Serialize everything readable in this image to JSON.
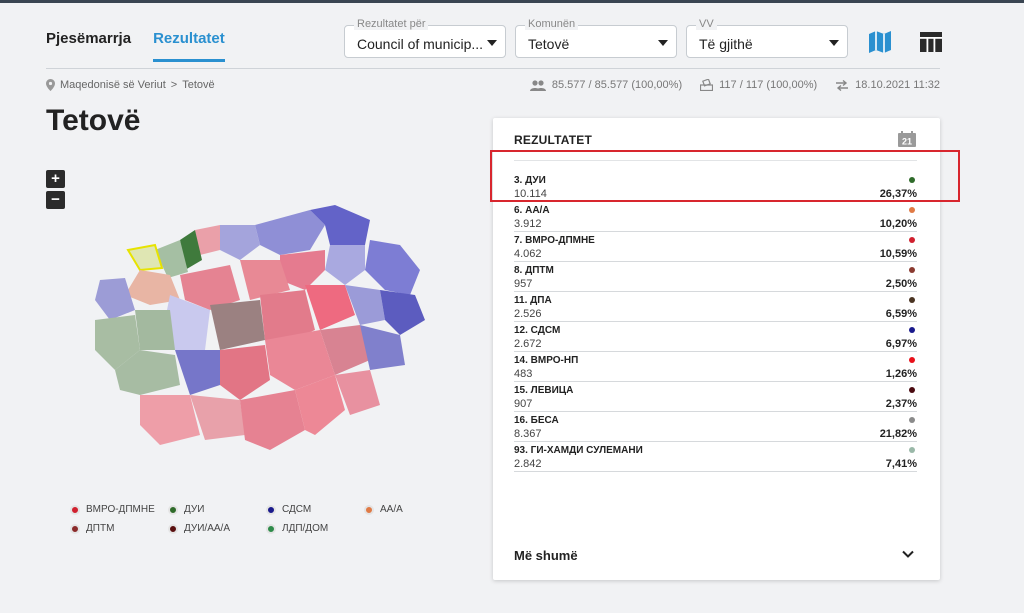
{
  "tabs": [
    {
      "label": "Pjesëmarrja",
      "active": false
    },
    {
      "label": "Rezultatet",
      "active": true
    }
  ],
  "filters": {
    "results_for": {
      "label": "Rezultatet për",
      "value": "Council of municip..."
    },
    "municipality": {
      "label": "Komunën",
      "value": "Tetovë"
    },
    "polling_station": {
      "label": "VV",
      "value": "Të gjithë"
    }
  },
  "breadcrumb": {
    "country": "Maqedonisë së Veriut",
    "separator": ">",
    "city": "Tetovë"
  },
  "stats": {
    "voters": "85.577 / 85.577 (100,00%)",
    "stations": "117 / 117 (100,00%)",
    "updated": "18.10.2021 11:32"
  },
  "page_title": "Tetovë",
  "zoom": {
    "in": "+",
    "out": "−"
  },
  "legend": [
    {
      "label": "ВМРО-ДПМНЕ",
      "color": "#d0202e"
    },
    {
      "label": "ДУИ",
      "color": "#2f6b2a"
    },
    {
      "label": "СДСМ",
      "color": "#1a1a8c"
    },
    {
      "label": "АА/А",
      "color": "#e07a45"
    },
    {
      "label": "ДПТМ",
      "color": "#8a2a2a"
    },
    {
      "label": "ДУИ/АА/А",
      "color": "#5a1010"
    },
    {
      "label": "ЛДП/ДОМ",
      "color": "#2e8b4a"
    }
  ],
  "panel": {
    "title": "REZULTATET",
    "calendar_badge": "21",
    "more_label": "Më shumë",
    "results": [
      {
        "name": "3. ДУИ",
        "votes": "10.114",
        "percent": "26,37%",
        "color": "#2f6b2a"
      },
      {
        "name": "6. АА/А",
        "votes": "3.912",
        "percent": "10,20%",
        "color": "#e07a45"
      },
      {
        "name": "7. ВМРО-ДПМНЕ",
        "votes": "4.062",
        "percent": "10,59%",
        "color": "#d0202e"
      },
      {
        "name": "8. ДПТМ",
        "votes": "957",
        "percent": "2,50%",
        "color": "#8a3a30"
      },
      {
        "name": "11. ДПА",
        "votes": "2.526",
        "percent": "6,59%",
        "color": "#4a3422"
      },
      {
        "name": "12. СДСМ",
        "votes": "2.672",
        "percent": "6,97%",
        "color": "#1a1a8c"
      },
      {
        "name": "14. ВМРО-НП",
        "votes": "483",
        "percent": "1,26%",
        "color": "#e8101a"
      },
      {
        "name": "15. ЛЕВИЦА",
        "votes": "907",
        "percent": "2,37%",
        "color": "#4a0a10"
      },
      {
        "name": "16. БЕСА",
        "votes": "8.367",
        "percent": "21,82%",
        "color": "#8a8a8a"
      },
      {
        "name": "93. ГИ-ХАМДИ СУЛЕМАНИ",
        "votes": "2.842",
        "percent": "7,41%",
        "color": "#9ab8a8"
      }
    ]
  },
  "icons": {
    "map_view": "map-icon",
    "table_view": "table-icon",
    "location": "location-pin-icon",
    "voters": "people-icon",
    "stations": "ballot-box-icon",
    "updated": "swap-arrows-icon",
    "calendar": "calendar-icon",
    "expand": "chevron-down-icon"
  },
  "colors": {
    "accent": "#2a90d0",
    "highlight": "#d8262e"
  }
}
